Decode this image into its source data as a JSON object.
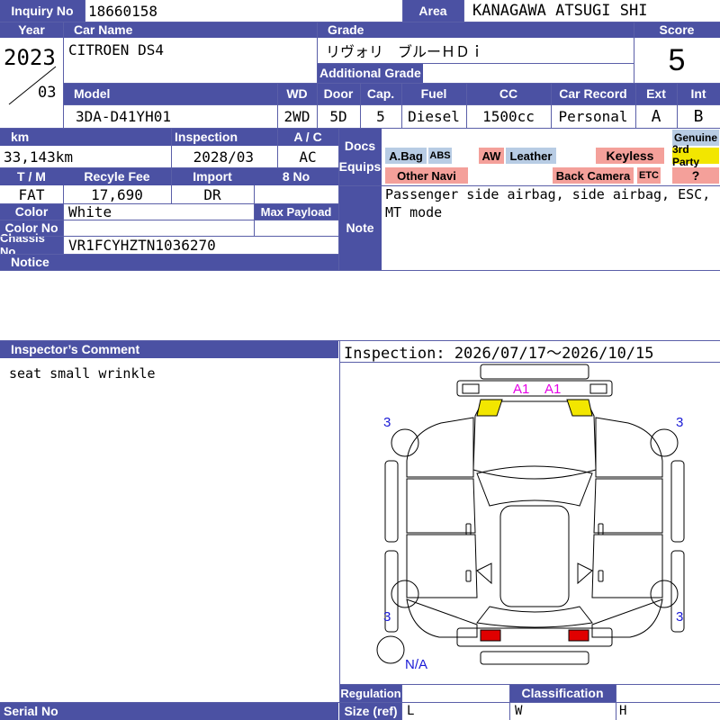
{
  "labels": {
    "inquiry_no": "Inquiry No",
    "area": "Area",
    "year": "Year",
    "car_name": "Car Name",
    "grade": "Grade",
    "score": "Score",
    "additional_grade": "Additional Grade",
    "model": "Model",
    "wd": "WD",
    "door": "Door",
    "cap": "Cap.",
    "fuel": "Fuel",
    "cc": "CC",
    "car_record": "Car Record",
    "ext": "Ext",
    "int": "Int",
    "km": "km",
    "inspection": "Inspection",
    "ac": "A / C",
    "docs": "Docs",
    "equips": "Equips",
    "tm": "T / M",
    "recycle_fee": "Recyle Fee",
    "import": "Import",
    "eight_no": "8 No",
    "color": "Color",
    "max_payload": "Max Payload",
    "color_no": "Color No",
    "chassis_no": "Chassis No",
    "notice": "Notice",
    "note": "Note",
    "inspectors_comment": "Inspector’s Comment",
    "regulation": "Regulation",
    "size_ref": "Size (ref)",
    "classification": "Classification",
    "serial_no": "Serial No"
  },
  "values": {
    "inquiry_no": "18660158",
    "area": "KANAGAWA ATSUGI SHI",
    "year": "2023",
    "month": "03",
    "car_name": "CITROEN DS4",
    "grade": "リヴォリ　ブルーＨＤｉ",
    "additional_grade": "",
    "score": "5",
    "model": "3DA-D41YH01",
    "wd": "2WD",
    "door": "5D",
    "cap": "5",
    "fuel": "Diesel",
    "cc": "1500cc",
    "car_record": "Personal",
    "ext": "A",
    "int": "B",
    "km": "33,143km",
    "inspection": "2028/03",
    "ac": "AC",
    "tm": "FAT",
    "recycle_fee": "17,690",
    "import": "DR",
    "eight_no": "",
    "color": "White",
    "max_payload": "",
    "color_no": "",
    "chassis_no": "VR1FCYHZTN1036270",
    "notice": "",
    "note": "Passenger side airbag, side airbag, ESC, MT mode",
    "inspectors_comment": "seat small wrinkle",
    "inspection_period": "Inspection: 2026/07/17～2026/10/15",
    "size_l": "L",
    "size_w": "W",
    "size_h": "H",
    "regulation": "",
    "classification": "",
    "serial_no": ""
  },
  "equips": {
    "abag": "A.Bag",
    "abs": "ABS",
    "aw": "AW",
    "leather": "Leather",
    "keyless": "Keyless",
    "genuine": "Genuine",
    "third_party": "3rd Party",
    "other_navi": "Other Navi",
    "back_camera": "Back Camera",
    "etc": "ETC",
    "unknown": "?"
  },
  "diagram": {
    "front_marks": [
      "A1",
      "A1"
    ],
    "tire_depth": [
      "3",
      "3",
      "3",
      "3"
    ],
    "spare": "N/A"
  },
  "colors": {
    "header": "#4b51a3",
    "line": "#5a5fa8",
    "equip_blue": "#b8cce4",
    "equip_red": "#f4a09a",
    "equip_yellow": "#f2e600",
    "damage_mark": "#e600e6",
    "tire_mark": "#1a1ad6"
  }
}
